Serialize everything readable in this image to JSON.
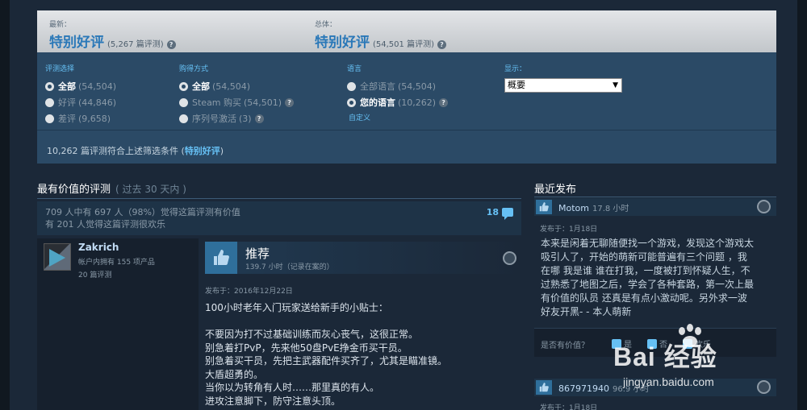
{
  "summary": {
    "recent_label": "最新：",
    "recent_value": "特别好评",
    "recent_count": "(5,267 篇评测)",
    "overall_label": "总体：",
    "overall_value": "特别好评",
    "overall_count": "(54,501 篇评测)"
  },
  "filters": {
    "review_type": {
      "title": "评测选择",
      "options": [
        {
          "label": "全部",
          "count": "(54,504)",
          "selected": true
        },
        {
          "label": "好评",
          "count": "(44,846)",
          "selected": false
        },
        {
          "label": "差评",
          "count": "(9,658)",
          "selected": false
        }
      ]
    },
    "purchase_type": {
      "title": "购得方式",
      "options": [
        {
          "label": "全部",
          "count": "(54,504)",
          "selected": true
        },
        {
          "label": "Steam 购买",
          "count": "(54,501)",
          "selected": false
        },
        {
          "label": "序列号激活",
          "count": "(3)",
          "selected": false
        }
      ]
    },
    "language": {
      "title": "语言",
      "options": [
        {
          "label": "全部语言",
          "count": "(54,504)",
          "selected": false
        },
        {
          "label": "您的语言",
          "count": "(10,262)",
          "selected": true
        }
      ],
      "custom_link": "自定义"
    },
    "display": {
      "title": "显示：",
      "selected": "概要"
    },
    "match_text": "10,262 篇评测符合上述筛选条件 (",
    "match_highlight": "特别好评",
    "match_end": ")"
  },
  "main": {
    "title": "最有价值的评测",
    "subtitle": "( 过去 30 天内 )",
    "helpful_line1": "709 人中有 697 人（98%）觉得这篇评测有价值",
    "helpful_line2": "有 201 人觉得这篇评测很欢乐",
    "comment_count": "18",
    "author": {
      "name": "Zakrich",
      "products": "帐户内拥有 155 项产品",
      "reviews": "20 篇评测"
    },
    "review": {
      "title": "推荐",
      "hours": "139.7 小时（记录在案的）",
      "posted": "发布于：2016年12月22日",
      "lines": [
        "100小时老年入门玩家送给新手的小贴士：",
        "",
        "不要因为打不过基础训练而灰心丧气，这很正常。",
        "别急着打PvP，先来他50盘PvE挣金币买干员。",
        "别急着买干员，先把主武器配件买齐了，尤其是瞄准镜。",
        "大盾超勇的。",
        "当你以为转角有人时……那里真的有人。",
        "进攻注意脚下，防守注意头顶。"
      ]
    }
  },
  "recent": {
    "title": "最近发布",
    "first": {
      "name": "Motom",
      "hours": "17.8 小时",
      "date": "发布于：1月18日",
      "lines": [
        "本来是闲着无聊随便找一个游戏，发现这个游戏太",
        "吸引人了，开始的萌新可能普遍有三个问题 ，我",
        "在哪 我是谁 谁在打我，一度被打到怀疑人生，不",
        "过熟悉了地图之后，学会了各种套路，第一次上最",
        "有价值的队员 还真是有点小激动呢。另外求一波",
        "好友开黑- - 本人萌新"
      ],
      "helpful_label": "是否有价值？",
      "vote_yes": "是",
      "vote_no": "否",
      "vote_funny": "欢乐"
    },
    "second": {
      "name": "867971940",
      "hours": "96.9 小时",
      "date": "发布于：1月18日"
    }
  },
  "watermark": {
    "brand": "Bai 经验",
    "url": "jingyan.baidu.com"
  },
  "colors": {
    "accent": "#66c0f4",
    "rating_blue": "#2a78b8",
    "background": "#1b2838"
  }
}
